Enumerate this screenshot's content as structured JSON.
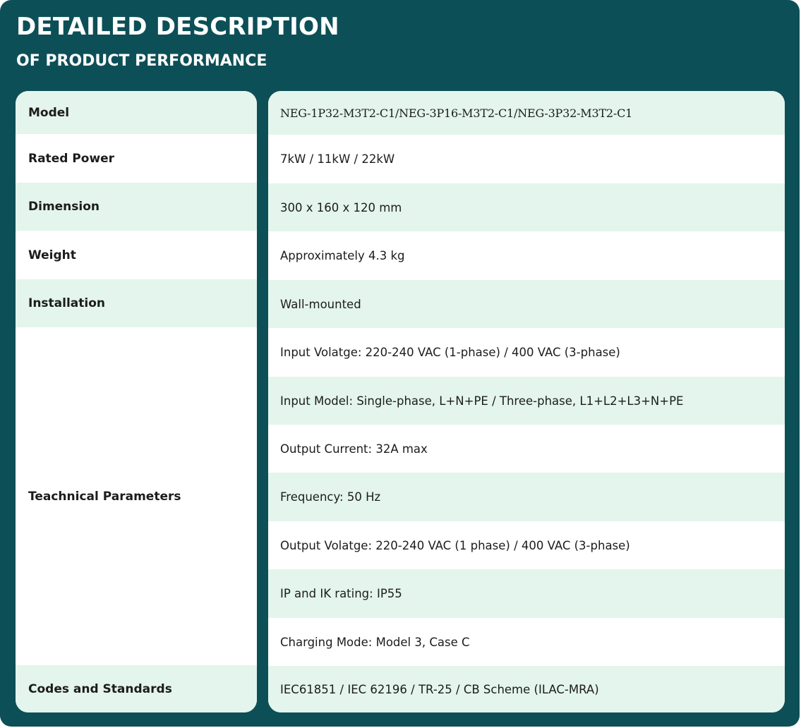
{
  "header": {
    "title": "DETAILED DESCRIPTION",
    "subtitle": "OF PRODUCT PERFORMANCE"
  },
  "colors": {
    "panel_background": "#0d4f57",
    "row_shade": "#e3f5ec",
    "row_plain": "#ffffff",
    "text": "#1c1c1c"
  },
  "table": {
    "labels": [
      "Model",
      "Rated Power",
      "Dimension",
      "Weight",
      "Installation",
      "Teachnical Parameters",
      "Codes and Standards"
    ],
    "values": [
      "NEG-1P32-M3T2-C1/NEG-3P16-M3T2-C1/NEG-3P32-M3T2-C1",
      "7kW / 11kW / 22kW",
      "300 x 160 x 120 mm",
      "Approximately 4.3 kg",
      "Wall-mounted",
      "Input Volatge: 220-240 VAC (1-phase) / 400 VAC (3-phase)",
      "Input Model: Single-phase, L+N+PE / Three-phase, L1+L2+L3+N+PE",
      "Output Current: 32A max",
      "Frequency: 50 Hz",
      "Output Volatge: 220-240 VAC (1 phase) / 400 VAC (3-phase)",
      "IP and IK rating: IP55",
      "Charging Mode: Model 3, Case C",
      "IEC61851 / IEC 62196 / TR-25 / CB Scheme (ILAC-MRA)"
    ]
  }
}
